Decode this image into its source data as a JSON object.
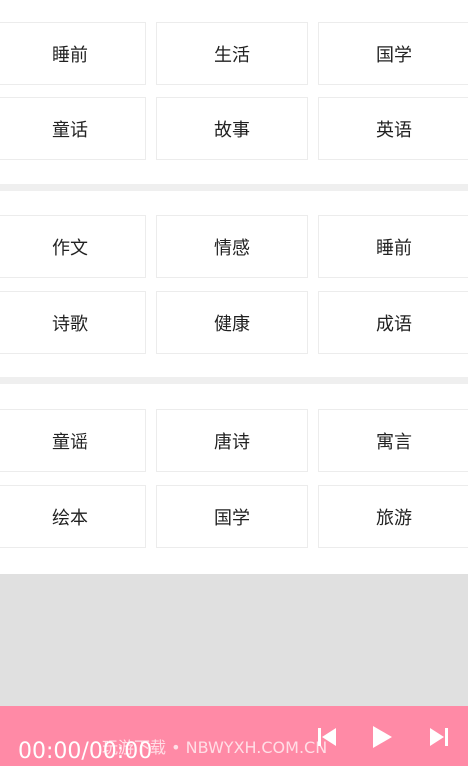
{
  "categories": {
    "section1": [
      "睡前",
      "生活",
      "国学",
      "童话",
      "故事",
      "英语"
    ],
    "section2": [
      "作文",
      "情感",
      "睡前",
      "诗歌",
      "健康",
      "成语"
    ],
    "section3": [
      "童谣",
      "唐诗",
      "寓言",
      "绘本",
      "国学",
      "旅游"
    ]
  },
  "player": {
    "time": "00:00/00:00",
    "watermark": "玩游下载 • NBWYXH.COM.CN",
    "accent_color": "#ff8aa6",
    "controls": [
      "skip-previous-icon",
      "play-icon",
      "skip-next-icon"
    ]
  }
}
